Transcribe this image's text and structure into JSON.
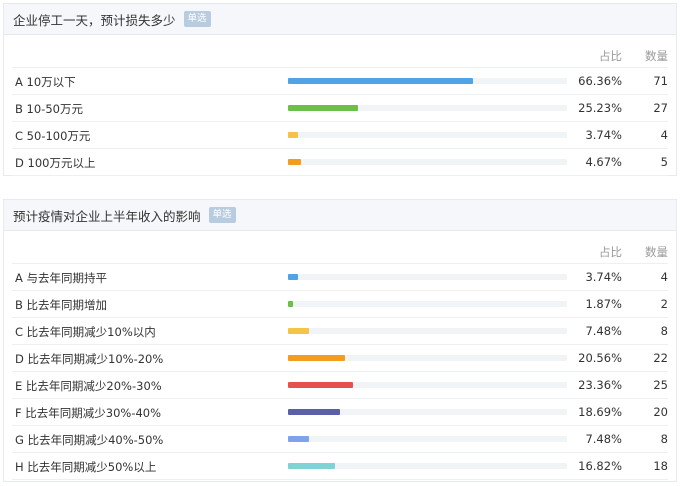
{
  "questions": [
    {
      "title": "企业停工一天，预计损失多少",
      "badge": "单选",
      "col_pct": "占比",
      "col_count": "数量",
      "options": [
        {
          "label": "A 10万以下",
          "percent": "66.36%",
          "count": "71",
          "fraction": 0.6636,
          "color": "#4fa3e6"
        },
        {
          "label": "B 10-50万元",
          "percent": "25.23%",
          "count": "27",
          "fraction": 0.2523,
          "color": "#6cc04a"
        },
        {
          "label": "C 50-100万元",
          "percent": "3.74%",
          "count": "4",
          "fraction": 0.0374,
          "color": "#f6c342"
        },
        {
          "label": "D 100万元以上",
          "percent": "4.67%",
          "count": "5",
          "fraction": 0.0467,
          "color": "#f39c1e"
        }
      ]
    },
    {
      "title": "预计疫情对企业上半年收入的影响",
      "badge": "单选",
      "col_pct": "占比",
      "col_count": "数量",
      "options": [
        {
          "label": "A 与去年同期持平",
          "percent": "3.74%",
          "count": "4",
          "fraction": 0.0374,
          "color": "#4fa3e6"
        },
        {
          "label": "B 比去年同期增加",
          "percent": "1.87%",
          "count": "2",
          "fraction": 0.0187,
          "color": "#6cc04a"
        },
        {
          "label": "C 比去年同期减少10%以内",
          "percent": "7.48%",
          "count": "8",
          "fraction": 0.0748,
          "color": "#f6c342"
        },
        {
          "label": "D 比去年同期减少10%-20%",
          "percent": "20.56%",
          "count": "22",
          "fraction": 0.2056,
          "color": "#f39c1e"
        },
        {
          "label": "E 比去年同期减少20%-30%",
          "percent": "23.36%",
          "count": "25",
          "fraction": 0.2336,
          "color": "#e8504f"
        },
        {
          "label": "F 比去年同期减少30%-40%",
          "percent": "18.69%",
          "count": "20",
          "fraction": 0.1869,
          "color": "#5b5fa8"
        },
        {
          "label": "G 比去年同期减少40%-50%",
          "percent": "7.48%",
          "count": "8",
          "fraction": 0.0748,
          "color": "#7fa2ec"
        },
        {
          "label": "H 比去年同期减少50%以上",
          "percent": "16.82%",
          "count": "18",
          "fraction": 0.1682,
          "color": "#7ed3d4"
        }
      ]
    }
  ]
}
